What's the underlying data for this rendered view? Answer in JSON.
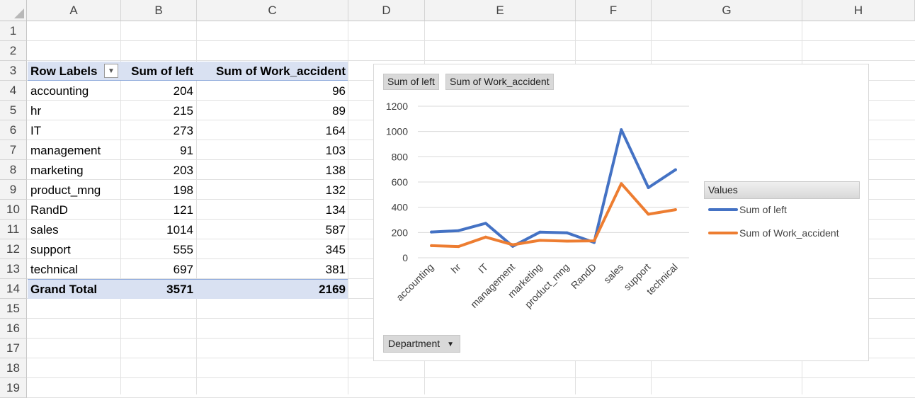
{
  "columns": [
    "A",
    "B",
    "C",
    "D",
    "E",
    "F",
    "G",
    "H"
  ],
  "rows": [
    "1",
    "2",
    "3",
    "4",
    "5",
    "6",
    "7",
    "8",
    "9",
    "10",
    "11",
    "12",
    "13",
    "14",
    "15",
    "16",
    "17",
    "18",
    "19"
  ],
  "pivot": {
    "headers": [
      "Row Labels",
      "Sum of left",
      "Sum of Work_accident"
    ],
    "rows": [
      {
        "label": "accounting",
        "left": "204",
        "work": "96"
      },
      {
        "label": "hr",
        "left": "215",
        "work": "89"
      },
      {
        "label": "IT",
        "left": "273",
        "work": "164"
      },
      {
        "label": "management",
        "left": "91",
        "work": "103"
      },
      {
        "label": "marketing",
        "left": "203",
        "work": "138"
      },
      {
        "label": "product_mng",
        "left": "198",
        "work": "132"
      },
      {
        "label": "RandD",
        "left": "121",
        "work": "134"
      },
      {
        "label": "sales",
        "left": "1014",
        "work": "587"
      },
      {
        "label": "support",
        "left": "555",
        "work": "345"
      },
      {
        "label": "technical",
        "left": "697",
        "work": "381"
      }
    ],
    "grand_total": {
      "label": "Grand Total",
      "left": "3571",
      "work": "2169"
    }
  },
  "chart": {
    "chips": [
      "Sum of left",
      "Sum of Work_accident"
    ],
    "legend_title": "Values",
    "filter_button": "Department",
    "colors": {
      "left": "#4472c4",
      "work": "#ed7d31",
      "grid": "#d9d9d9"
    }
  },
  "chart_data": {
    "type": "line",
    "categories": [
      "accounting",
      "hr",
      "IT",
      "management",
      "marketing",
      "product_mng",
      "RandD",
      "sales",
      "support",
      "technical"
    ],
    "series": [
      {
        "name": "Sum of left",
        "values": [
          204,
          215,
          273,
          91,
          203,
          198,
          121,
          1014,
          555,
          697
        ]
      },
      {
        "name": "Sum of Work_accident",
        "values": [
          96,
          89,
          164,
          103,
          138,
          132,
          134,
          587,
          345,
          381
        ]
      }
    ],
    "ylim": [
      0,
      1200
    ],
    "yticks": [
      0,
      200,
      400,
      600,
      800,
      1000,
      1200
    ],
    "grid": true,
    "legend": "right"
  }
}
